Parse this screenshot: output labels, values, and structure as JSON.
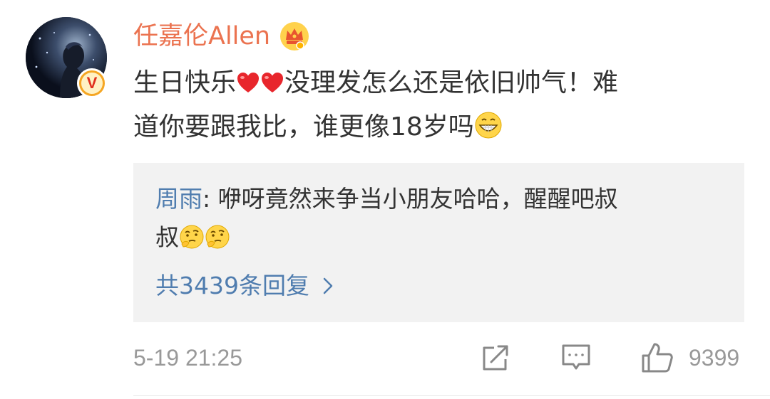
{
  "comment": {
    "username": "任嘉伦Allen",
    "crown_icon": "crown-icon",
    "verified_icon": "verified-v-icon",
    "verified_mark": "V",
    "content_line1_a": "生日快乐",
    "content_line1_b": "没理发怎么还是依旧帅气！难",
    "content_line2": "道你要跟我比，谁更像18岁吗",
    "emojis": [
      "heart-emoji",
      "heart-emoji",
      "grin-emoji"
    ]
  },
  "reply": {
    "author": "周雨",
    "separator": ": ",
    "text_line1": "咿呀竟然来争当小朋友哈哈，醒醒吧叔",
    "text_line2": "叔",
    "emojis": [
      "thinking-emoji",
      "thinking-emoji"
    ],
    "count_label": "共3439条回复"
  },
  "footer": {
    "timestamp": "5-19 21:25",
    "share_icon": "share-icon",
    "comment_icon": "comment-icon",
    "like_icon": "thumbs-up-icon",
    "like_count": "9399"
  },
  "colors": {
    "username": "#eb7350",
    "link": "#507daf",
    "text": "#333333",
    "muted": "#999999",
    "reply_bg": "#f2f2f2"
  }
}
